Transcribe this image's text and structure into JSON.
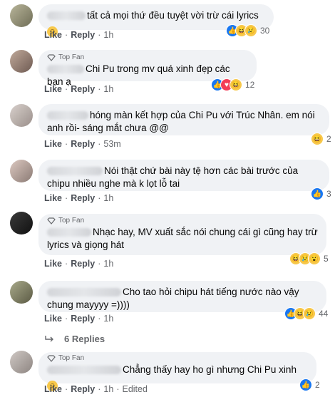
{
  "labels": {
    "like": "Like",
    "reply": "Reply",
    "dot": "·",
    "top_fan": "Top Fan",
    "edited": "Edited"
  },
  "comments": [
    {
      "text": "tất cả mọi thứ đều tuyệt vời trừ cái lyrics",
      "emoji": "😊",
      "time": "1h",
      "reactions": [
        "like",
        "haha",
        "sad"
      ],
      "count": "30",
      "top_fan": false
    },
    {
      "text": "Chi Pu trong mv quá xinh đẹp các bạn ạ",
      "time": "1h",
      "reactions": [
        "like",
        "love",
        "haha"
      ],
      "count": "12",
      "top_fan": true
    },
    {
      "text": "hóng màn kết hợp của Chi Pu với Trúc Nhân. em nói anh rồi- sáng mắt chưa @@",
      "time": "53m",
      "reactions": [
        "haha"
      ],
      "count": "2",
      "top_fan": false
    },
    {
      "text": "Nói thật chứ bài này tệ hơn các bài trước của chipu nhiều nghe mà k lọt lỗ tai",
      "time": "1h",
      "reactions": [
        "like"
      ],
      "count": "3",
      "top_fan": false
    },
    {
      "text": "Nhạc hay, MV xuất sắc nói chung cái gì cũng hay trừ lyrics và giọng hát",
      "time": "1h",
      "reactions": [
        "haha",
        "sad",
        "wow"
      ],
      "count": "5",
      "top_fan": true
    },
    {
      "text": "Cho tao hỏi chipu hát tiếng nước nào vậy chung mayyyy =))))",
      "time": "1h",
      "reactions": [
        "like",
        "haha",
        "sad"
      ],
      "count": "44",
      "top_fan": false
    },
    {
      "text": "Chẳng thấy hay ho gì nhưng Chi Pu xinh",
      "emoji": "😊",
      "time": "1h",
      "reactions": [
        "like"
      ],
      "count": "2",
      "top_fan": true,
      "edited": true
    }
  ],
  "replies_link": "6 Replies",
  "icons": {
    "top_fan_badge": "diamond-badge-icon",
    "reply_arrow": "reply-arrow-icon"
  },
  "colors": {
    "like": "#1877f2",
    "love": "#f33e58",
    "haha": "#f7c84b",
    "bubble": "#f0f2f5"
  }
}
